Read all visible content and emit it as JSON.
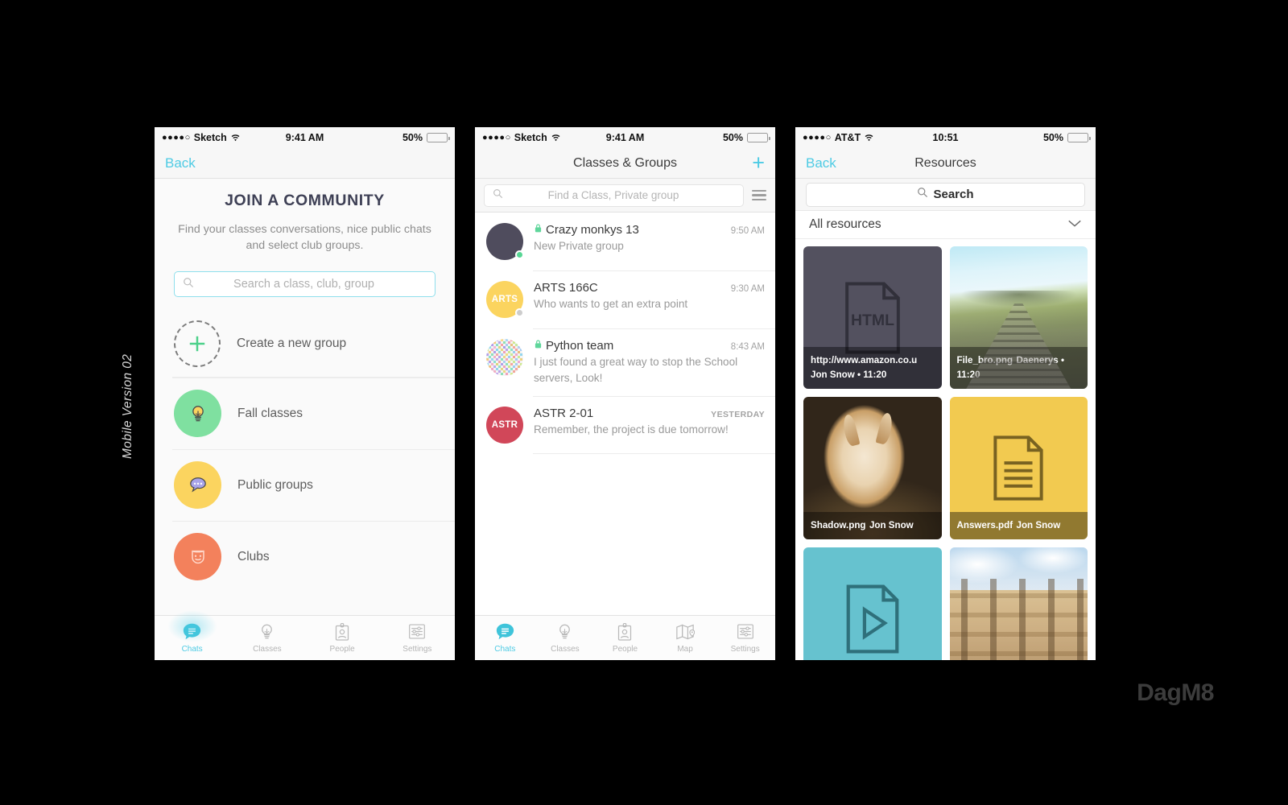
{
  "caption": "Mobile Version 02",
  "watermark": "DagM8",
  "colors": {
    "accent_teal": "#4ecbe4",
    "green": "#7fe0a0",
    "yellow": "#fbd45f",
    "orange": "#f3815c",
    "dark_slate": "#4f4c5d",
    "red": "#d14759",
    "battery_yellow": "#fdc62e",
    "tile_dark": "#53515f",
    "tile_yellow": "#f2ca50",
    "tile_teal": "#66c2cf"
  },
  "phone1": {
    "status": {
      "dots": "●●●●○",
      "carrier": "Sketch",
      "time": "9:41 AM",
      "battery_pct": "50%"
    },
    "nav": {
      "back": "Back"
    },
    "title": "JOIN A COMMUNITY",
    "subtitle": "Find your classes conversations, nice public chats and select club groups.",
    "search": {
      "placeholder": "Search a class, club, group",
      "value": "",
      "icon": "search-icon"
    },
    "items": [
      {
        "label": "Create a new group",
        "icon": "plus-icon",
        "style": "dashed"
      },
      {
        "label": "Fall classes",
        "icon": "lightbulb-icon",
        "color": "#7fe0a0"
      },
      {
        "label": "Public groups",
        "icon": "speech-bubble-icon",
        "color": "#fbd45f"
      },
      {
        "label": "Clubs",
        "icon": "theater-mask-icon",
        "color": "#f3815c"
      }
    ],
    "tabs": [
      {
        "label": "Chats",
        "icon": "chat-bubble-icon",
        "active": true
      },
      {
        "label": "Classes",
        "icon": "lightbulb-icon",
        "active": false
      },
      {
        "label": "People",
        "icon": "id-badge-icon",
        "active": false
      },
      {
        "label": "Settings",
        "icon": "sliders-icon",
        "active": false
      }
    ]
  },
  "phone2": {
    "status": {
      "dots": "●●●●○",
      "carrier": "Sketch",
      "time": "9:41 AM",
      "battery_pct": "50%"
    },
    "nav": {
      "title": "Classes & Groups",
      "add": "+"
    },
    "search": {
      "placeholder": "Find a Class, Private group",
      "value": "",
      "icon": "search-icon",
      "filter_icon": "filter-list-icon"
    },
    "chats": [
      {
        "name": "Crazy monkys 13",
        "locked": true,
        "preview": "New Private group",
        "time": "9:50 AM",
        "time_upper": false,
        "avatar": {
          "type": "solid",
          "color": "#4f4c5d",
          "initials": ""
        },
        "presence": "#57d694"
      },
      {
        "name": "ARTS 166C",
        "locked": false,
        "preview": "Who wants to get an extra point",
        "time": "9:30 AM",
        "time_upper": false,
        "avatar": {
          "type": "initials",
          "color": "#fbd45f",
          "initials": "ARTS"
        },
        "presence": "#c8c8c8"
      },
      {
        "name": "Python team",
        "locked": true,
        "preview": "I just found a great way to stop the School servers, Look!",
        "time": "8:43 AM",
        "time_upper": false,
        "avatar": {
          "type": "noise",
          "color": "",
          "initials": ""
        },
        "presence": ""
      },
      {
        "name": "ASTR 2-01",
        "locked": false,
        "preview": "Remember, the project is due tomorrow!",
        "time": "YESTERDAY",
        "time_upper": true,
        "avatar": {
          "type": "initials",
          "color": "#d14759",
          "initials": "ASTR"
        },
        "presence": ""
      }
    ],
    "tabs": [
      {
        "label": "Chats",
        "icon": "chat-bubble-icon",
        "active": true
      },
      {
        "label": "Classes",
        "icon": "lightbulb-icon",
        "active": false
      },
      {
        "label": "People",
        "icon": "id-badge-icon",
        "active": false
      },
      {
        "label": "Map",
        "icon": "map-pin-icon",
        "active": false
      },
      {
        "label": "Settings",
        "icon": "sliders-icon",
        "active": false
      }
    ]
  },
  "phone3": {
    "status": {
      "dots": "●●●●○",
      "carrier": "AT&T",
      "time": "10:51",
      "battery_pct": "50%"
    },
    "nav": {
      "back": "Back",
      "title": "Resources"
    },
    "search": {
      "label": "Search",
      "placeholder": "Search",
      "value": "",
      "icon": "search-icon"
    },
    "filter": {
      "label": "All resources",
      "icon": "chevron-down-icon"
    },
    "tiles": [
      {
        "title": "http://www.amazon.co.u",
        "meta": "Jon Snow • 11:20",
        "kind": "html-doc",
        "bg": "#53515f",
        "badge": "HTML"
      },
      {
        "title": "File_bro.png",
        "meta": "Daenerys • 11:20",
        "kind": "photo-railway",
        "bg": "",
        "badge": ""
      },
      {
        "title": "Shadow.png",
        "meta": "Jon Snow",
        "kind": "photo-dog",
        "bg": "",
        "badge": ""
      },
      {
        "title": "Answers.pdf",
        "meta": "Jon Snow",
        "kind": "pdf-doc",
        "bg": "#f2ca50",
        "badge": ""
      },
      {
        "title": "",
        "meta": "",
        "kind": "video-doc",
        "bg": "#66c2cf",
        "badge": ""
      },
      {
        "title": "",
        "meta": "",
        "kind": "photo-building",
        "bg": "",
        "badge": ""
      }
    ]
  }
}
